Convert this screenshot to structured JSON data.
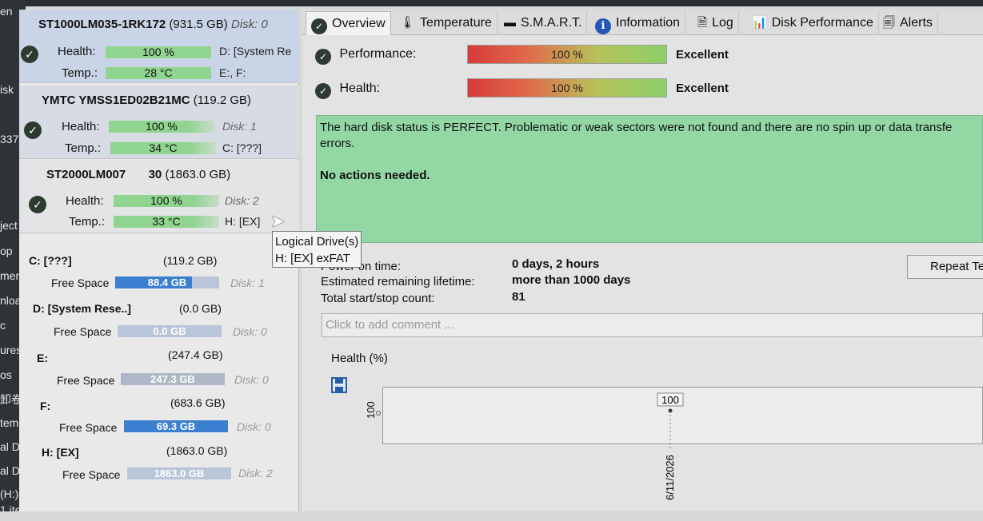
{
  "left_strip": [
    "en",
    "isk",
    "337",
    "ject",
    "op",
    "men",
    "nload",
    "c",
    "ures",
    "os",
    "卸卷 (C",
    "tem Re",
    "al Disk",
    "al Disk",
    "(H:)",
    "1 ite"
  ],
  "disks": [
    {
      "title": "ST1000LM035-1RK172",
      "size": "(931.5 GB)",
      "disk": "Disk: 0",
      "health_label": "Health:",
      "health_value": "100 %",
      "health_side": "D: [System Re",
      "temp_label": "Temp.:",
      "temp_value": "28 °C",
      "temp_side": "E:, F:"
    },
    {
      "title": "YMTC YMSS1ED02B21MC",
      "size": "(119.2 GB)",
      "health_label": "Health:",
      "health_value": "100 %",
      "health_side": "Disk: 1",
      "temp_label": "Temp.:",
      "temp_value": "34 °C",
      "temp_side": "C: [???]"
    },
    {
      "title": "ST2000LM007",
      "title_suffix": "30",
      "size": "(1863.0 GB)",
      "health_label": "Health:",
      "health_value": "100 %",
      "health_side": "Disk: 2",
      "temp_label": "Temp.:",
      "temp_value": "33 °C",
      "temp_side": "H: [EX]"
    }
  ],
  "partitions": [
    {
      "name": "C: [???]",
      "size": "(119.2 GB)",
      "free_label": "Free Space",
      "free": "88.4 GB",
      "fill": 0.74,
      "disk": "Disk: 1"
    },
    {
      "name": "D: [System Rese..]",
      "size": "(0.0 GB)",
      "free_label": "Free Space",
      "free": "0.0 GB",
      "fill": 0.0,
      "disk": "Disk: 0"
    },
    {
      "name": "E:",
      "size": "(247.4 GB)",
      "free_label": "Free Space",
      "free": "247.3 GB",
      "fill": 0.0,
      "disk": "Disk: 0"
    },
    {
      "name": "F:",
      "size": "(683.6 GB)",
      "free_label": "Free Space",
      "free": "69.3 GB",
      "fill": 1.0,
      "disk": "Disk: 0"
    },
    {
      "name": "H: [EX]",
      "size": "(1863.0 GB)",
      "free_label": "Free Space",
      "free": "1863.0 GB",
      "fill": 0.0,
      "disk": "Disk: 2"
    }
  ],
  "tabs": [
    "Overview",
    "Temperature",
    "S.M.A.R.T.",
    "Information",
    "Log",
    "Disk Performance",
    "Alerts"
  ],
  "overview": {
    "performance_label": "Performance:",
    "performance_value": "100 %",
    "performance_rating": "Excellent",
    "health_label": "Health:",
    "health_value": "100 %",
    "health_rating": "Excellent",
    "status_line1": "The hard disk status is PERFECT. Problematic or weak sectors were not found and there are no spin up or data transfe",
    "status_line2": "errors.",
    "action": "No actions needed.",
    "power_on_label": "Power on time:",
    "power_on_value": "0 days, 2 hours",
    "lifetime_label": "Estimated remaining lifetime:",
    "lifetime_value": "more than 1000 days",
    "startstop_label": "Total start/stop count:",
    "startstop_value": "81",
    "repeat_button": "Repeat Te",
    "comment_placeholder": "Click to add comment ...",
    "health_chart_label": "Health (%)"
  },
  "chart_data": {
    "type": "line",
    "title": "",
    "ylabel": "",
    "y_tick_labels": [
      "100"
    ],
    "x": [
      "6/11/2026"
    ],
    "series": [
      {
        "values": [
          100
        ]
      }
    ],
    "data_labels": [
      "100"
    ],
    "grid": false
  },
  "tooltip": {
    "line1": "Logical Drive(s)",
    "line2": "H: [EX] exFAT"
  },
  "colors": {
    "health_bar": "#8fd48f",
    "status_box": "#93d7a5",
    "free_fill": "#3a7fd0",
    "accent_blue": "#2458b8"
  }
}
